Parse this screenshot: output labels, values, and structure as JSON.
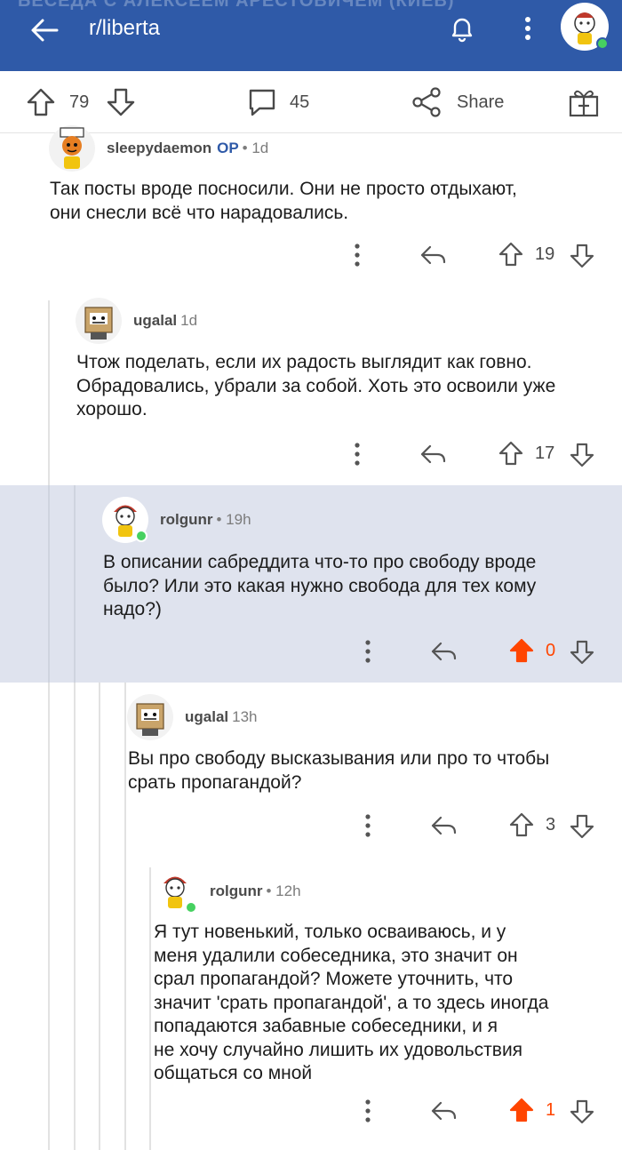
{
  "header": {
    "title": "r/liberta",
    "ghost_text": "БЕСЕДА С АЛЕКСЕЕМ АРЕСТОВИЧЕМ (КИЕВ)"
  },
  "action_bar": {
    "upvotes": "79",
    "comments": "45",
    "share_label": "Share"
  },
  "comments": [
    {
      "author": "sleepydaemon",
      "flair": "OP",
      "meta": "• 1d",
      "text": "Так посты вроде посносили. Они не просто отдыхают,\nони снесли всё что нарадовались.",
      "score": "19",
      "voted": false
    },
    {
      "author": "ugalal",
      "flair": "",
      "meta": "1d",
      "text": "Чтож поделать, если их радость выглядит как говно.\nОбрадовались, убрали за собой. Хоть это освоили уже\nхорошо.",
      "score": "17",
      "voted": false
    },
    {
      "author": "rolgunr",
      "flair": "",
      "meta": "• 19h",
      "text": "В описании сабреддита что-то про свободу вроде\nбыло? Или это какая нужно свобода для тех кому\nнадо?)",
      "score": "0",
      "voted": true
    },
    {
      "author": "ugalal",
      "flair": "",
      "meta": "13h",
      "text": "Вы про свободу высказывания или про то чтобы\nсрать пропагандой?",
      "score": "3",
      "voted": false
    },
    {
      "author": "rolgunr",
      "flair": "",
      "meta": "• 12h",
      "text": "Я тут новенький, только осваиваюсь, и у\nменя удалили собеседника, это значит он\nсрал пропагандой? Можете уточнить, что\nзначит 'срать пропагандой', а то здесь иногда\nпопадаются забавные собеседники, и я\nне хочу случайно лишить их удовольствия\nобщаться со мной",
      "score": "1",
      "voted": true
    }
  ],
  "colors": {
    "header_bg": "#2f5aa8",
    "highlight_bg": "#dfe3ee",
    "upvote_orange": "#ff4500",
    "op_blue": "#2f5aa8"
  }
}
